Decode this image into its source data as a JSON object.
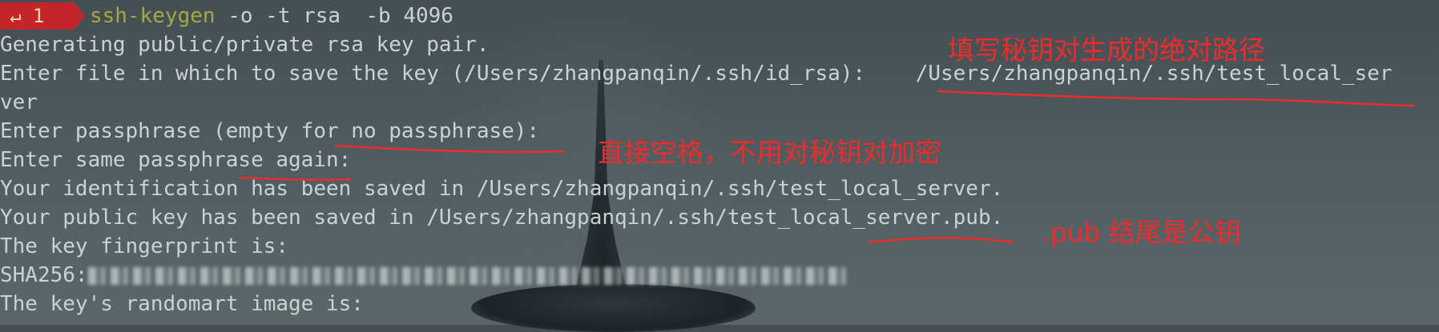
{
  "prompt": {
    "return_symbol": "↵",
    "line_number": "1"
  },
  "command": {
    "name": "ssh-keygen",
    "args": "-o -t rsa  -b 4096"
  },
  "output": {
    "line1": "Generating public/private rsa key pair.",
    "line2_prefix": "Enter file in which to save the key (/Users/zhangpanqin/.ssh/id_rsa):    ",
    "line2_input": "/Users/zhangpanqin/.ssh/test_local_ser",
    "line3": "ver",
    "line4": "Enter passphrase (empty for no passphrase):",
    "line5": "Enter same passphrase again:",
    "line6": "Your identification has been saved in /Users/zhangpanqin/.ssh/test_local_server.",
    "line7": "Your public key has been saved in /Users/zhangpanqin/.ssh/test_local_server.pub.",
    "line8": "The key fingerprint is:",
    "line9_prefix": "SHA256:",
    "line10": "The key's randomart image is:"
  },
  "annotations": {
    "path_note": "填写秘钥对生成的绝对路径",
    "passphrase_note": "直接空格，不用对秘钥对加密",
    "pubkey_note": ".pub 结尾是公钥"
  },
  "colors": {
    "text": "#cbd2d3",
    "command": "#a3a947",
    "badge": "#c4252b",
    "annotation": "#ef2b2b"
  }
}
